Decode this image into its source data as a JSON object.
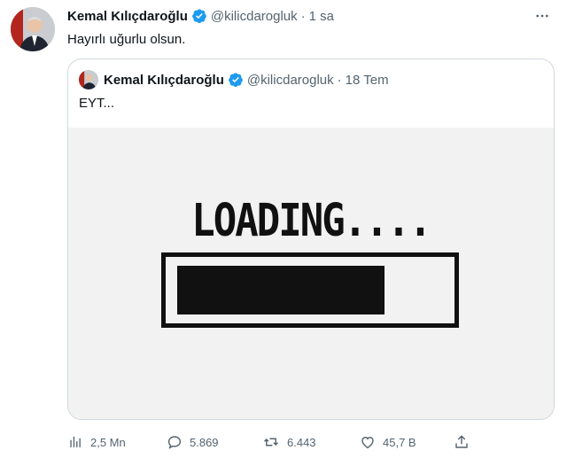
{
  "author": {
    "name": "Kemal Kılıçdaroğlu",
    "handle": "@kilicdarogluk",
    "time": "1 sa"
  },
  "tweet": {
    "text": "Hayırlı uğurlu olsun."
  },
  "quoted": {
    "name": "Kemal Kılıçdaroğlu",
    "handle": "@kilicdarogluk",
    "time": "18 Tem",
    "text": "EYT...",
    "media": {
      "loading_text": "LOADING....",
      "progress": 0.78
    }
  },
  "actions": {
    "views": "2,5 Mn",
    "replies": "5.869",
    "retweets": "6.443",
    "likes": "45,7 B"
  },
  "colors": {
    "verified": "#1d9bf0",
    "muted": "#536471",
    "border": "#cfd9de"
  }
}
